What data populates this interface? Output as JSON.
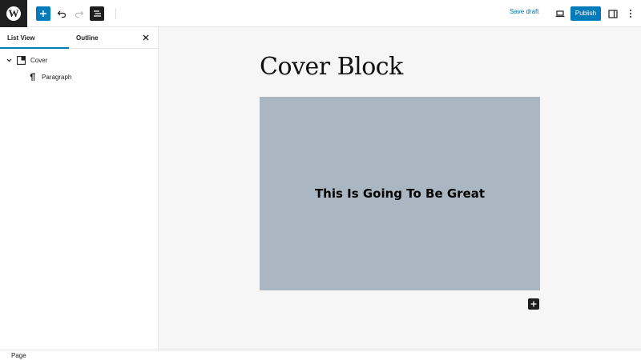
{
  "toolbar": {
    "logo_letter": "W",
    "logo_icon": "wordpress-logo-icon",
    "add_icon": "plus-icon",
    "undo_icon": "undo-icon",
    "redo_icon": "redo-icon",
    "listview_icon": "list-view-icon",
    "save_draft_label": "Save draft",
    "preview_icon": "laptop-icon",
    "publish_label": "Publish",
    "settings_icon": "sidebar-toggle-icon",
    "options_icon": "more-vertical-icon"
  },
  "sidebar": {
    "tabs": [
      {
        "label": "List View",
        "active": true
      },
      {
        "label": "Outline",
        "active": false
      }
    ],
    "close_icon": "close-icon",
    "tree": [
      {
        "label": "Cover",
        "icon": "cover-block-icon",
        "expanded": true
      },
      {
        "label": "Paragraph",
        "icon": "paragraph-icon"
      }
    ]
  },
  "editor": {
    "title": "Cover Block",
    "cover_text": "This Is Going To Be Great",
    "cover_color": "#aab6c2",
    "append_icon": "plus-icon"
  },
  "footer": {
    "breadcrumb": "Page"
  },
  "colors": {
    "accent": "#007cba",
    "dark": "#1e1e1e",
    "canvas": "#f6f6f6"
  }
}
